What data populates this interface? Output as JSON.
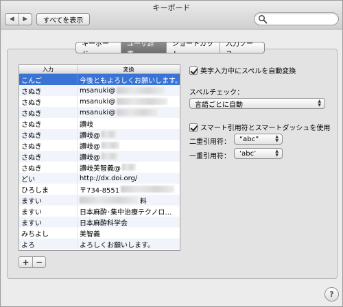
{
  "window": {
    "title": "キーボード"
  },
  "toolbar": {
    "back_glyph": "◀",
    "forward_glyph": "▶",
    "show_all_label": "すべてを表示",
    "search_placeholder": "",
    "search_icon": "search-icon"
  },
  "tabs": [
    {
      "label": "キーボード",
      "active": false
    },
    {
      "label": "ユーザ辞書",
      "active": true
    },
    {
      "label": "ショートカット",
      "active": false
    },
    {
      "label": "入力ソース",
      "active": false
    }
  ],
  "dictionary": {
    "columns": [
      "入力",
      "変換"
    ],
    "rows": [
      {
        "input": "こんご",
        "output": "今後ともよろしくお願いします。",
        "selected": true
      },
      {
        "input": "さぬき",
        "output": "msanuki@"
      },
      {
        "input": "さぬき",
        "output": "msanuki@"
      },
      {
        "input": "さぬき",
        "output": "msanuki@"
      },
      {
        "input": "さぬき",
        "output": "讃岐"
      },
      {
        "input": "さぬき",
        "output": "讃岐@"
      },
      {
        "input": "さぬき",
        "output": "讃岐@"
      },
      {
        "input": "さぬき",
        "output": "讃岐@"
      },
      {
        "input": "さぬき",
        "output": "讃岐美智義@"
      },
      {
        "input": "どい",
        "output": "http://dx.doi.org/"
      },
      {
        "input": "ひろしま",
        "output": "〒734-8551"
      },
      {
        "input": "ますい",
        "output": "料"
      },
      {
        "input": "ますい",
        "output": "日本麻酔･集中治療テクノロ…"
      },
      {
        "input": "ますい",
        "output": "日本麻酔科学会"
      },
      {
        "input": "みちよし",
        "output": "美智義"
      },
      {
        "input": "よろ",
        "output": "よろしくお願いします。"
      }
    ],
    "add_label": "+",
    "remove_label": "−"
  },
  "options": {
    "auto_spell_label": "英字入力中にスペルを自動変換",
    "auto_spell_checked": true,
    "spell_check_label": "スペルチェック：",
    "spell_check_value": "言語ごとに自動",
    "smart_quotes_label": "スマート引用符とスマートダッシュを使用",
    "smart_quotes_checked": true,
    "double_quote_label": "二重引用符：",
    "double_quote_value": "“abc”",
    "single_quote_label": "一重引用符：",
    "single_quote_value": "‘abc’"
  },
  "help_label": "?"
}
